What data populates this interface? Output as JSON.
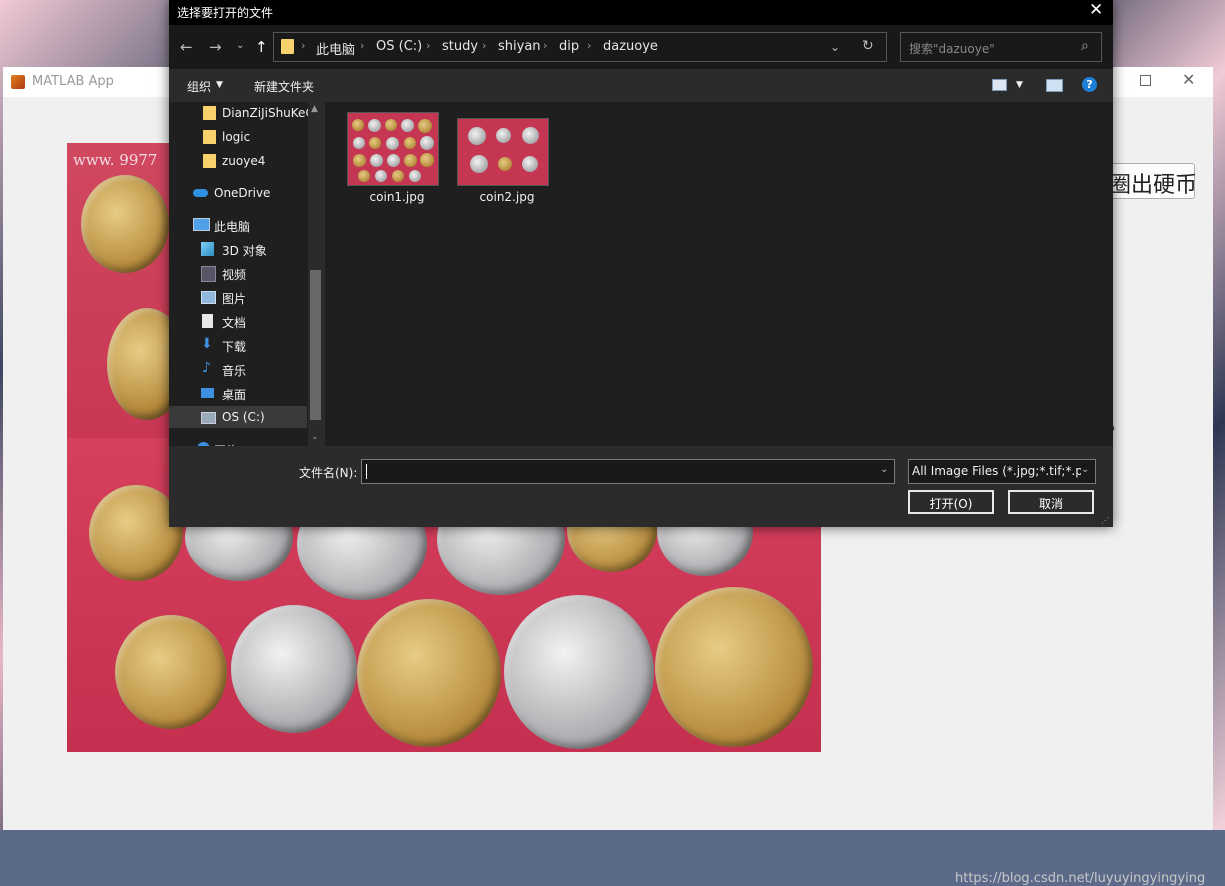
{
  "matlab_app": {
    "title": "MATLAB App",
    "watermark": "www. 9977",
    "button_label": "圈出硬币",
    "question_mark": "?",
    "footer_url": "https://blog.csdn.net/luyuyingyingying"
  },
  "dialog": {
    "title": "选择要打开的文件",
    "breadcrumb": [
      "此电脑",
      "OS (C:)",
      "study",
      "shiyan",
      "dip",
      "dazuoye"
    ],
    "search_placeholder": "搜索\"dazuoye\"",
    "toolbar": {
      "organize": "组织",
      "new_folder": "新建文件夹"
    },
    "sidebar": [
      {
        "label": "DianZiJiShuKeC",
        "icon": "folder-icon"
      },
      {
        "label": "logic",
        "icon": "folder-icon"
      },
      {
        "label": "zuoye4",
        "icon": "folder-icon"
      },
      {
        "label": "OneDrive",
        "icon": "cloud-icon"
      },
      {
        "label": "此电脑",
        "icon": "computer-icon"
      },
      {
        "label": "3D 对象",
        "icon": "cube-icon"
      },
      {
        "label": "视频",
        "icon": "video-icon"
      },
      {
        "label": "图片",
        "icon": "picture-icon"
      },
      {
        "label": "文档",
        "icon": "document-icon"
      },
      {
        "label": "下载",
        "icon": "download-icon"
      },
      {
        "label": "音乐",
        "icon": "music-icon"
      },
      {
        "label": "桌面",
        "icon": "desktop-icon"
      },
      {
        "label": "OS (C:)",
        "icon": "drive-icon",
        "selected": true
      },
      {
        "label": "网络",
        "icon": "network-icon"
      }
    ],
    "files": [
      {
        "name": "coin1.jpg"
      },
      {
        "name": "coin2.jpg"
      }
    ],
    "filename_label": "文件名(N):",
    "filename_value": "",
    "filter": "All Image Files (*.jpg;*.tif;*.pr",
    "open_button": "打开(O)",
    "cancel_button": "取消"
  }
}
